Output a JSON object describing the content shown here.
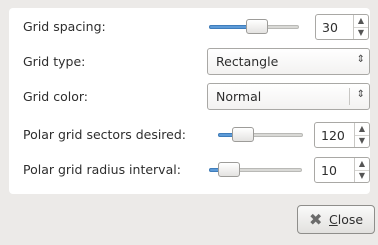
{
  "rows": {
    "grid_spacing": {
      "label": "Grid spacing:",
      "value": "30",
      "slider_fraction": 0.55
    },
    "grid_type": {
      "label": "Grid type:",
      "selected": "Rectangle"
    },
    "grid_color": {
      "label": "Grid color:",
      "selected": "Normal"
    },
    "polar_sectors": {
      "label": "Polar grid sectors desired:",
      "value": "120",
      "slider_fraction": 0.22
    },
    "polar_radius": {
      "label": "Polar grid radius interval:",
      "value": "10",
      "slider_fraction": 0.13
    }
  },
  "icons": {
    "spin_up": "▲",
    "spin_down": "▼",
    "combo_arrow": "⇕",
    "close_icon": "✖"
  },
  "close_button": {
    "mnemonic": "C",
    "rest": "lose"
  },
  "colors": {
    "accent": "#5d9bd8",
    "panel": "#ffffff",
    "window": "#eceae8"
  }
}
